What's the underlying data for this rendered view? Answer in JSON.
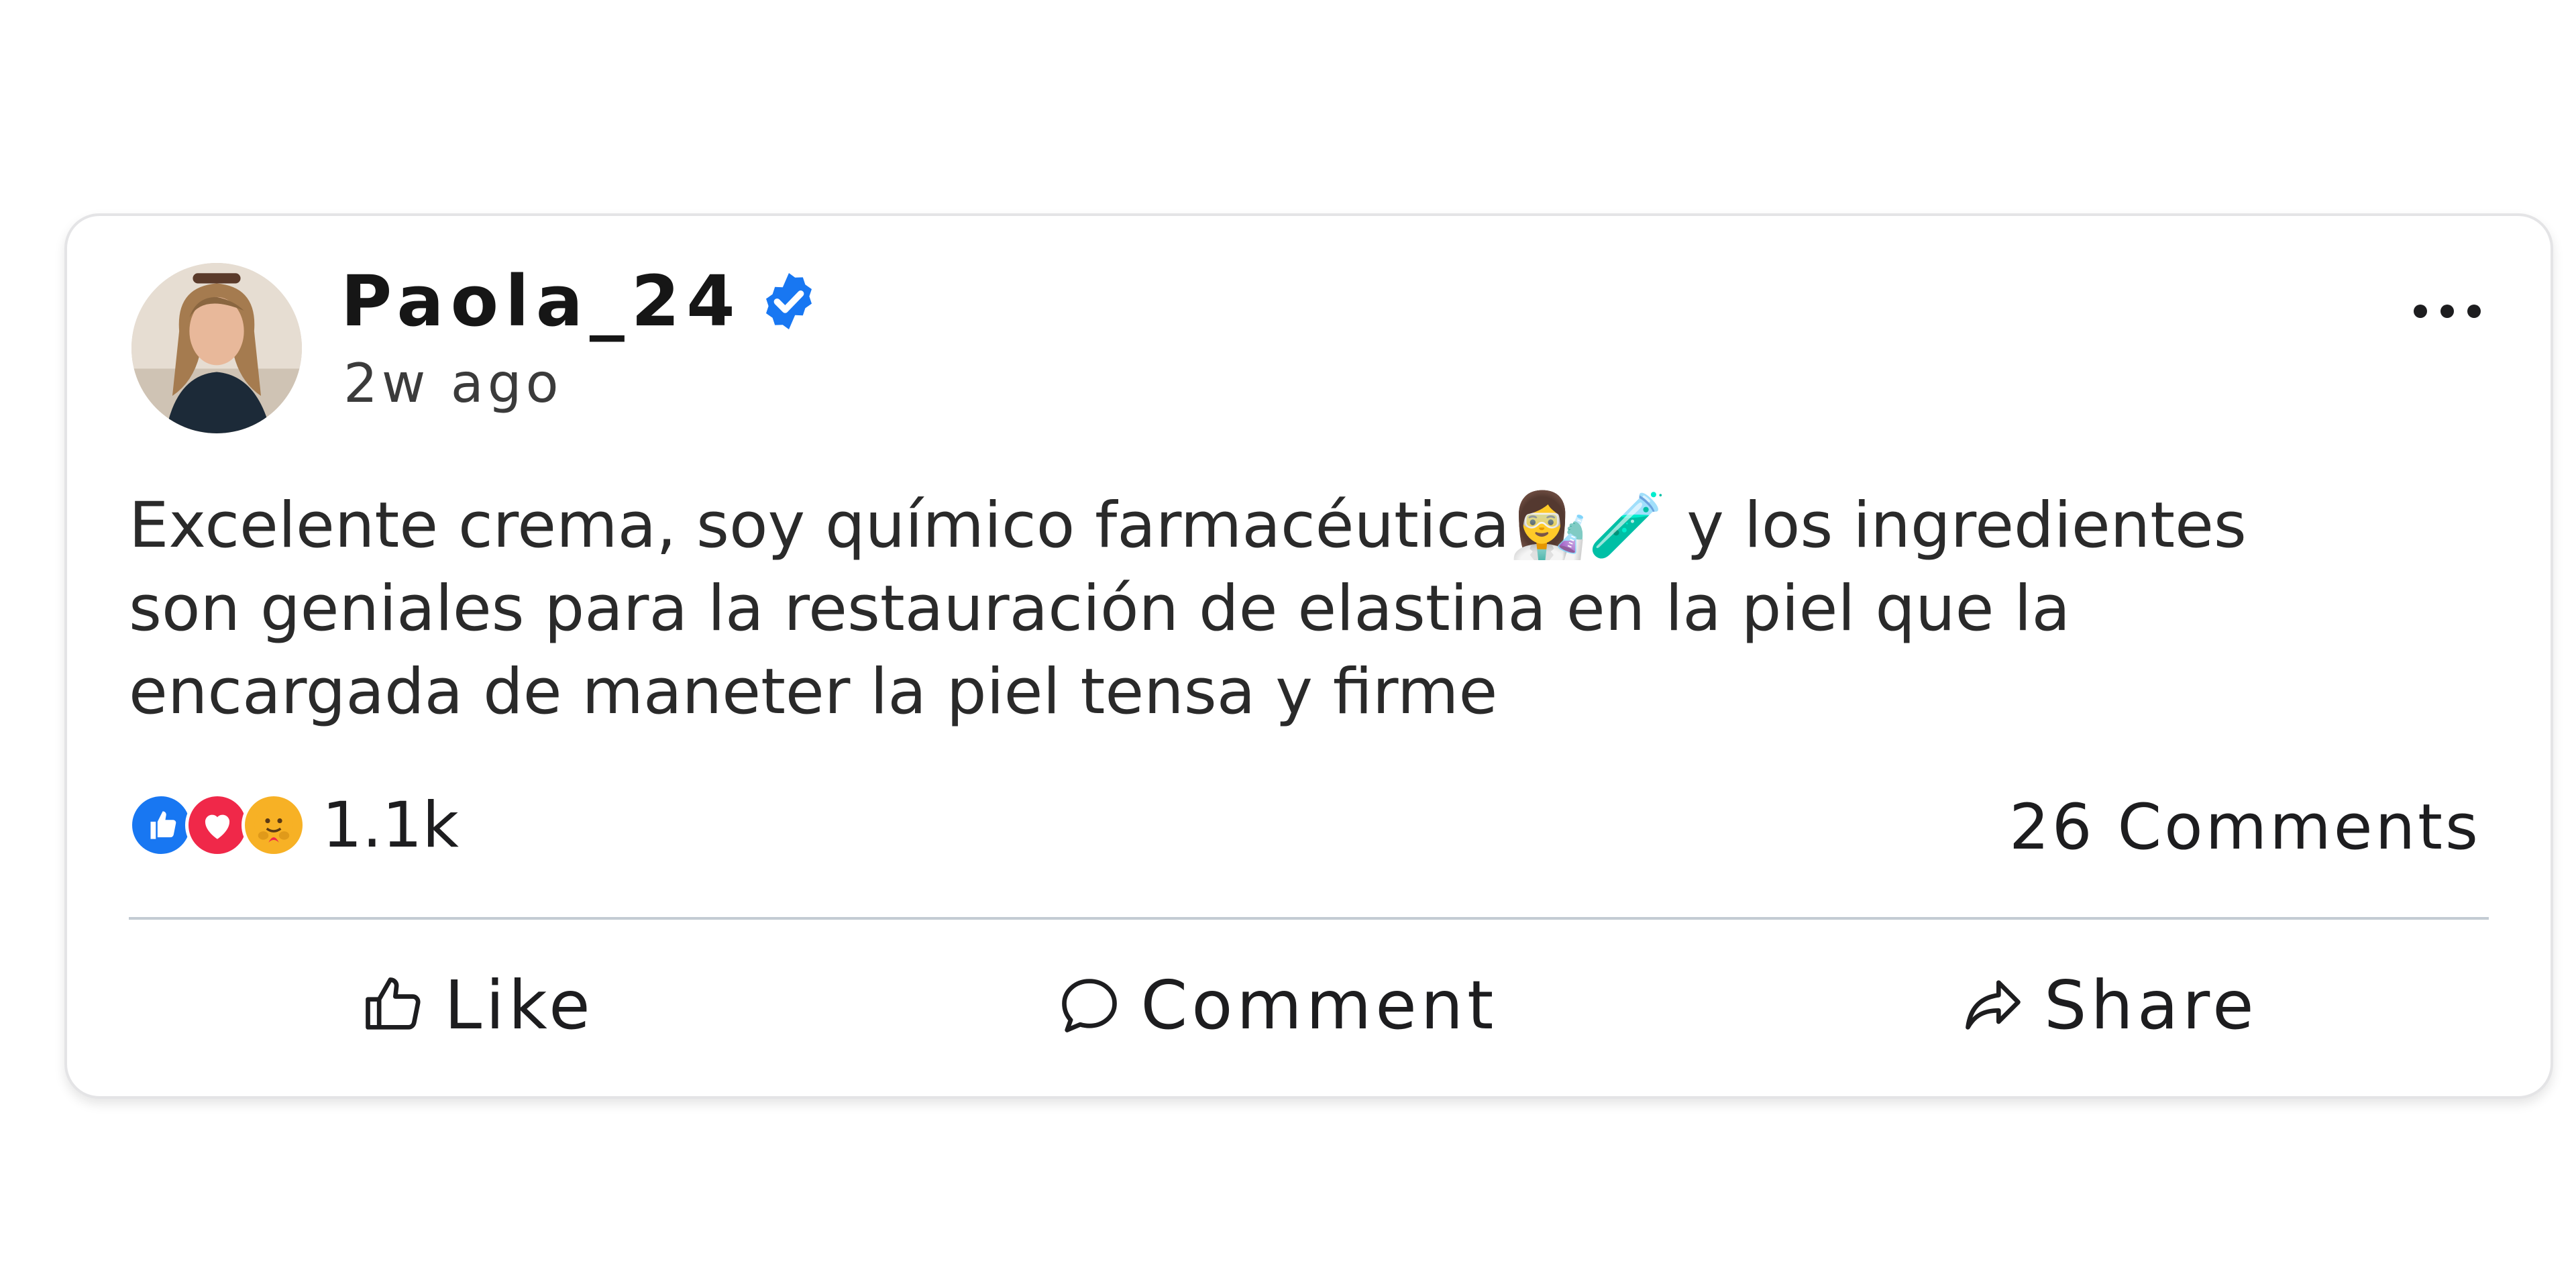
{
  "post": {
    "author": "Paola_24",
    "verified": true,
    "time": "2w ago",
    "text": "Excelente crema, soy químico farmacéutica👩‍🔬🧪 y los ingredientes\nson geniales para la restauración de elastina en la piel que la\nencargada de maneter la piel tensa y firme",
    "reactions": {
      "types": [
        "like",
        "love",
        "care"
      ],
      "count": "1.1k"
    },
    "comments_count": "26 Comments"
  },
  "actions": {
    "like": "Like",
    "comment": "Comment",
    "share": "Share"
  },
  "icons": {
    "verified": "verified-badge-icon",
    "more": "more-options-icon",
    "like": "thumbs-up-icon",
    "comment": "speech-bubble-icon",
    "share": "share-arrow-icon"
  },
  "colors": {
    "verified_blue": "#1877f2",
    "like_blue": "#1877f2",
    "love_red": "#f02849",
    "care_yellow": "#f7b125",
    "divider": "#c3cbd3",
    "card_border": "#e4e4e6"
  }
}
